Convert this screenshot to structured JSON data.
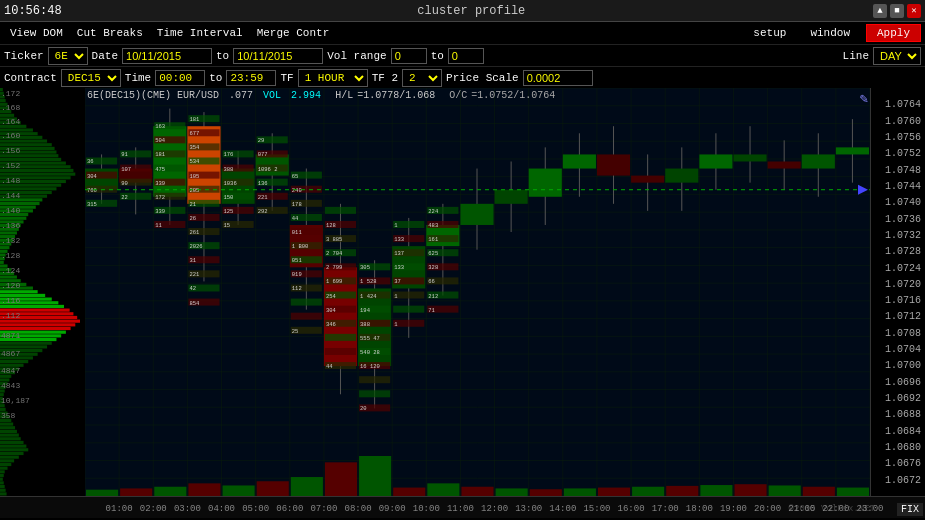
{
  "title": "cluster profile",
  "time": "10:56:48",
  "window_controls": {
    "minimize": "▲",
    "maximize": "■",
    "close": "✕"
  },
  "menu": {
    "items": [
      "View DOM",
      "Cut Breaks",
      "Time Interval",
      "Merge Contr"
    ]
  },
  "right_controls": {
    "setup": "setup",
    "window": "window",
    "apply": "Apply"
  },
  "toolbar1": {
    "ticker_label": "Ticker",
    "ticker_value": "6E",
    "date_label": "Date",
    "date_from": "10/11/2015",
    "date_to": "10/11/2015",
    "vol_range_label": "Vol range",
    "vol_from": "0",
    "vol_to": "0",
    "line_label": "Line",
    "line_value": "DAY"
  },
  "toolbar2": {
    "contract_label": "Contract",
    "contract_value": "DEC15",
    "time_label": "Time",
    "time_from": "00:00",
    "time_to": "23:59",
    "tf1_label": "TF",
    "tf1_value": "1 HOUR",
    "tf2_label": "TF 2",
    "tf2_value": "2",
    "price_scale_label": "Price Scale",
    "price_scale_value": "0.0002"
  },
  "chart_info": {
    "symbol": "6E(DEC15)(CME) EUR/USD",
    "last": ".077",
    "vol_label": "VOL",
    "vol_value": "2.994",
    "hl_label": "H/L",
    "hl_value": "1.0778/1.068",
    "oc_label": "O/C",
    "oc_value": "1.0752/1.0764"
  },
  "price_axis": {
    "prices": [
      {
        "price": "1.0764",
        "pct": 4
      },
      {
        "price": "1.0760",
        "pct": 8
      },
      {
        "price": "1.0756",
        "pct": 12
      },
      {
        "price": "1.0752",
        "pct": 16
      },
      {
        "price": "1.0748",
        "pct": 20
      },
      {
        "price": "1.0744",
        "pct": 24
      },
      {
        "price": "1.0740",
        "pct": 28
      },
      {
        "price": "1.0736",
        "pct": 32
      },
      {
        "price": "1.0732",
        "pct": 36
      },
      {
        "price": "1.0728",
        "pct": 40
      },
      {
        "price": "1.0724",
        "pct": 44
      },
      {
        "price": "1.0720",
        "pct": 48
      },
      {
        "price": "1.0716",
        "pct": 52
      },
      {
        "price": "1.0712",
        "pct": 56
      },
      {
        "price": "1.0708",
        "pct": 60
      },
      {
        "price": "1.0704",
        "pct": 64
      },
      {
        "price": "1.0700",
        "pct": 68
      },
      {
        "price": "1.0696",
        "pct": 72
      },
      {
        "price": "1.0692",
        "pct": 76
      },
      {
        "price": "1.0688",
        "pct": 80
      },
      {
        "price": "1.0684",
        "pct": 84
      },
      {
        "price": "1.0680",
        "pct": 88
      },
      {
        "price": "1.0676",
        "pct": 92
      },
      {
        "price": "1.0672",
        "pct": 96
      }
    ]
  },
  "time_axis": {
    "labels": [
      "01:00",
      "02:00",
      "03:00",
      "04:00",
      "05:00",
      "06:00",
      "07:00",
      "08:00",
      "09:00",
      "10:00",
      "11:00",
      "12:00",
      "13:00",
      "14:00",
      "15:00",
      "16:00",
      "17:00",
      "18:00",
      "19:00",
      "20:00",
      "21:00",
      "22:00",
      "23:00"
    ]
  },
  "copyright": "©2015 VolFix.NET",
  "fix_btn": "FIX"
}
